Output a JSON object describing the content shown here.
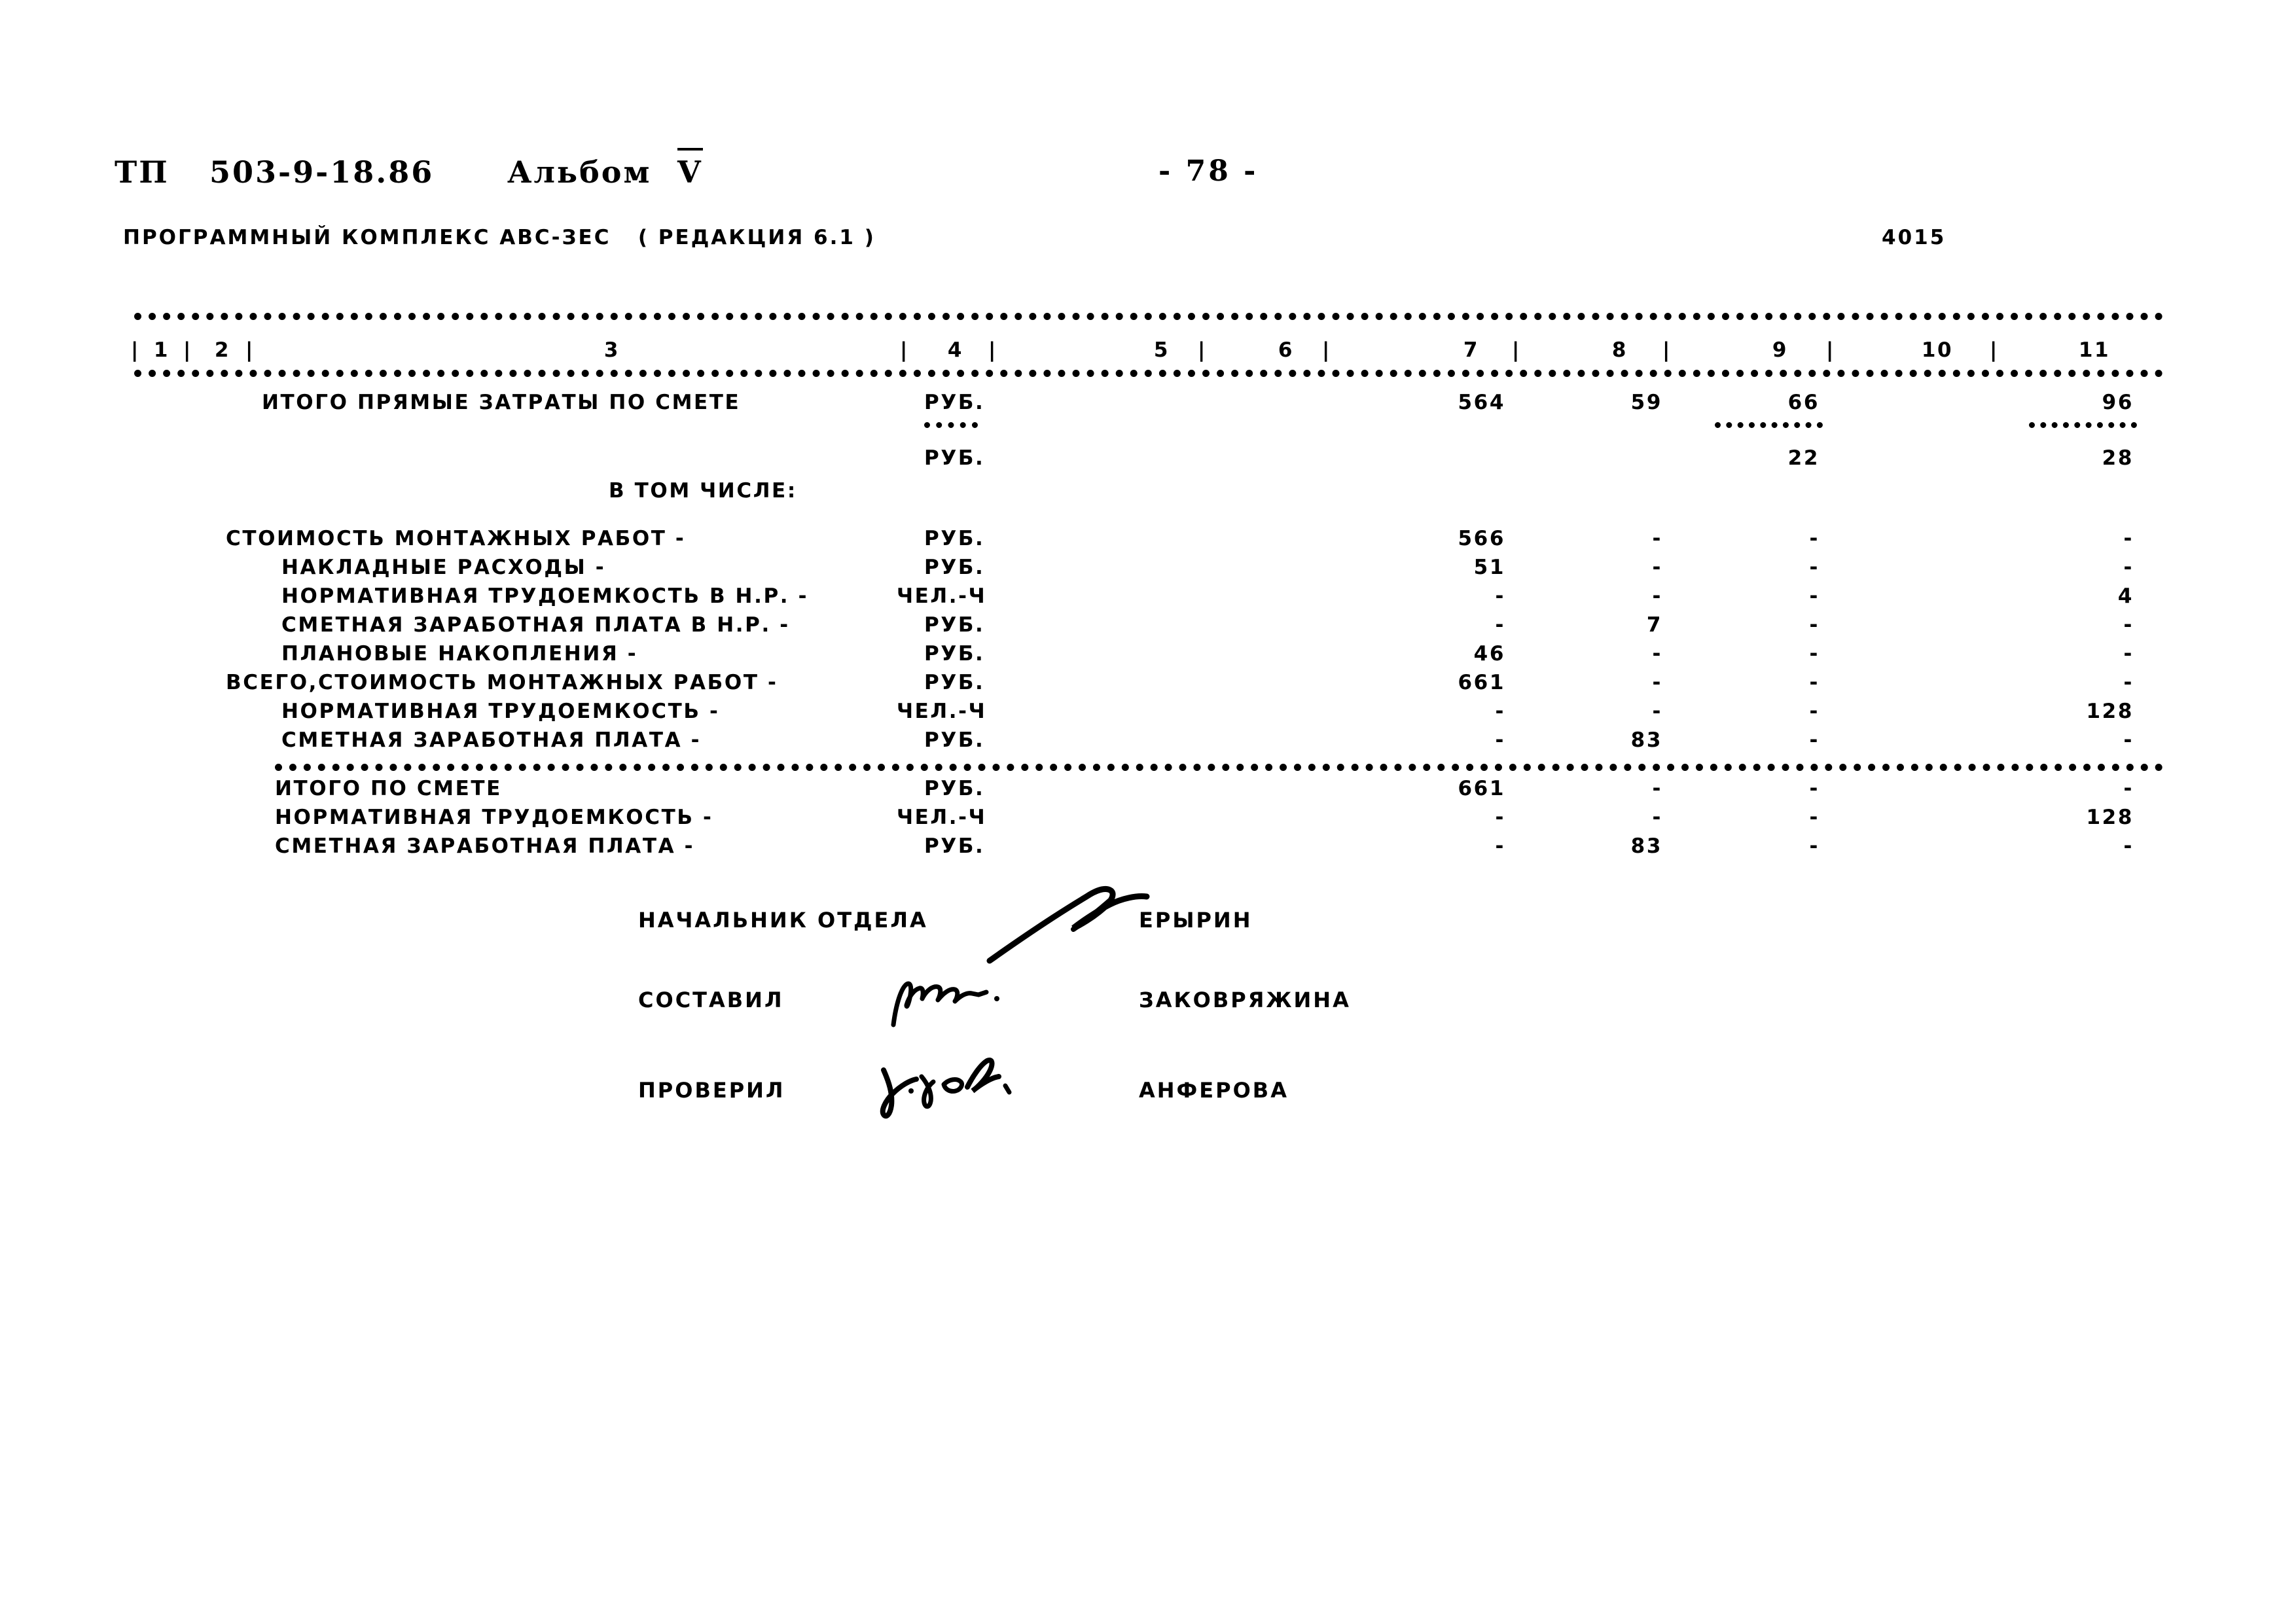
{
  "header": {
    "series_label": "ТП",
    "series_code": "503-9-18.86",
    "album_word": "Альбом",
    "album_number": "V",
    "page_number": "- 78 -",
    "software_line": "ПРОГРАММНЫЙ КОМПЛЕКС АВС-ЗЕС   ( РЕДАКЦИЯ 6.1 )",
    "doc_number": "4015"
  },
  "table": {
    "column_numbers": [
      "1",
      "2",
      "3",
      "4",
      "5",
      "6",
      "7",
      "8",
      "9",
      "10",
      "11"
    ],
    "in_which_label": "В ТОМ ЧИСЛЕ:",
    "total_direct": {
      "label": "ИТОГО ПРЯМЫЕ ЗАТРАТЫ ПО СМЕТЕ",
      "unit": "РУБ.",
      "c7": "564",
      "c8": "59",
      "c9": "66",
      "c11": "96"
    },
    "total_direct_sub": {
      "unit": "РУБ.",
      "c9": "22",
      "c11": "28"
    },
    "rows": [
      {
        "label": "СТОИМОСТЬ МОНТАЖНЫХ РАБОТ -",
        "indent": 0,
        "unit": "РУБ.",
        "c7": "566",
        "c8": "-",
        "c9": "-",
        "c11": "-"
      },
      {
        "label": "НАКЛАДНЫЕ РАСХОДЫ -",
        "indent": 1,
        "unit": "РУБ.",
        "c7": "51",
        "c8": "-",
        "c9": "-",
        "c11": "-"
      },
      {
        "label": "НОРМАТИВНАЯ ТРУДОЕМКОСТЬ В Н.Р. -",
        "indent": 1,
        "unit": "ЧЕЛ.-Ч",
        "c7": "-",
        "c8": "-",
        "c9": "-",
        "c11": "4"
      },
      {
        "label": "СМЕТНАЯ ЗАРАБОТНАЯ ПЛАТА В Н.Р. -",
        "indent": 1,
        "unit": "РУБ.",
        "c7": "-",
        "c8": "7",
        "c9": "-",
        "c11": "-"
      },
      {
        "label": "ПЛАНОВЫЕ НАКОПЛЕНИЯ -",
        "indent": 1,
        "unit": "РУБ.",
        "c7": "46",
        "c8": "-",
        "c9": "-",
        "c11": "-"
      },
      {
        "label": "ВСЕГО,СТОИМОСТЬ МОНТАЖНЫХ РАБОТ -",
        "indent": 0,
        "unit": "РУБ.",
        "c7": "661",
        "c8": "-",
        "c9": "-",
        "c11": "-"
      },
      {
        "label": "НОРМАТИВНАЯ ТРУДОЕМКОСТЬ -",
        "indent": 1,
        "unit": "ЧЕЛ.-Ч",
        "c7": "-",
        "c8": "-",
        "c9": "-",
        "c11": "128"
      },
      {
        "label": "СМЕТНАЯ ЗАРАБОТНАЯ ПЛАТА -",
        "indent": 1,
        "unit": "РУБ.",
        "c7": "-",
        "c8": "83",
        "c9": "-",
        "c11": "-"
      }
    ],
    "footer_rows": [
      {
        "label": "ИТОГО ПО СМЕТЕ",
        "unit": "РУБ.",
        "c7": "661",
        "c8": "-",
        "c9": "-",
        "c11": "-"
      },
      {
        "label": "НОРМАТИВНАЯ ТРУДОЕМКОСТЬ -",
        "unit": "ЧЕЛ.-Ч",
        "c7": "-",
        "c8": "-",
        "c9": "-",
        "c11": "128"
      },
      {
        "label": "СМЕТНАЯ ЗАРАБОТНАЯ ПЛАТА -",
        "unit": "РУБ.",
        "c7": "-",
        "c8": "83",
        "c9": "-",
        "c11": "-"
      }
    ]
  },
  "signatures": [
    {
      "role": "НАЧАЛЬНИК ОТДЕЛА",
      "name": "ЕРЫРИН"
    },
    {
      "role": "СОСТАВИЛ",
      "name": "ЗАКОВРЯЖИНА"
    },
    {
      "role": "ПРОВЕРИЛ",
      "name": "АНФЕРОВА"
    }
  ],
  "colors": {
    "ink": "#000000",
    "paper": "#ffffff"
  }
}
